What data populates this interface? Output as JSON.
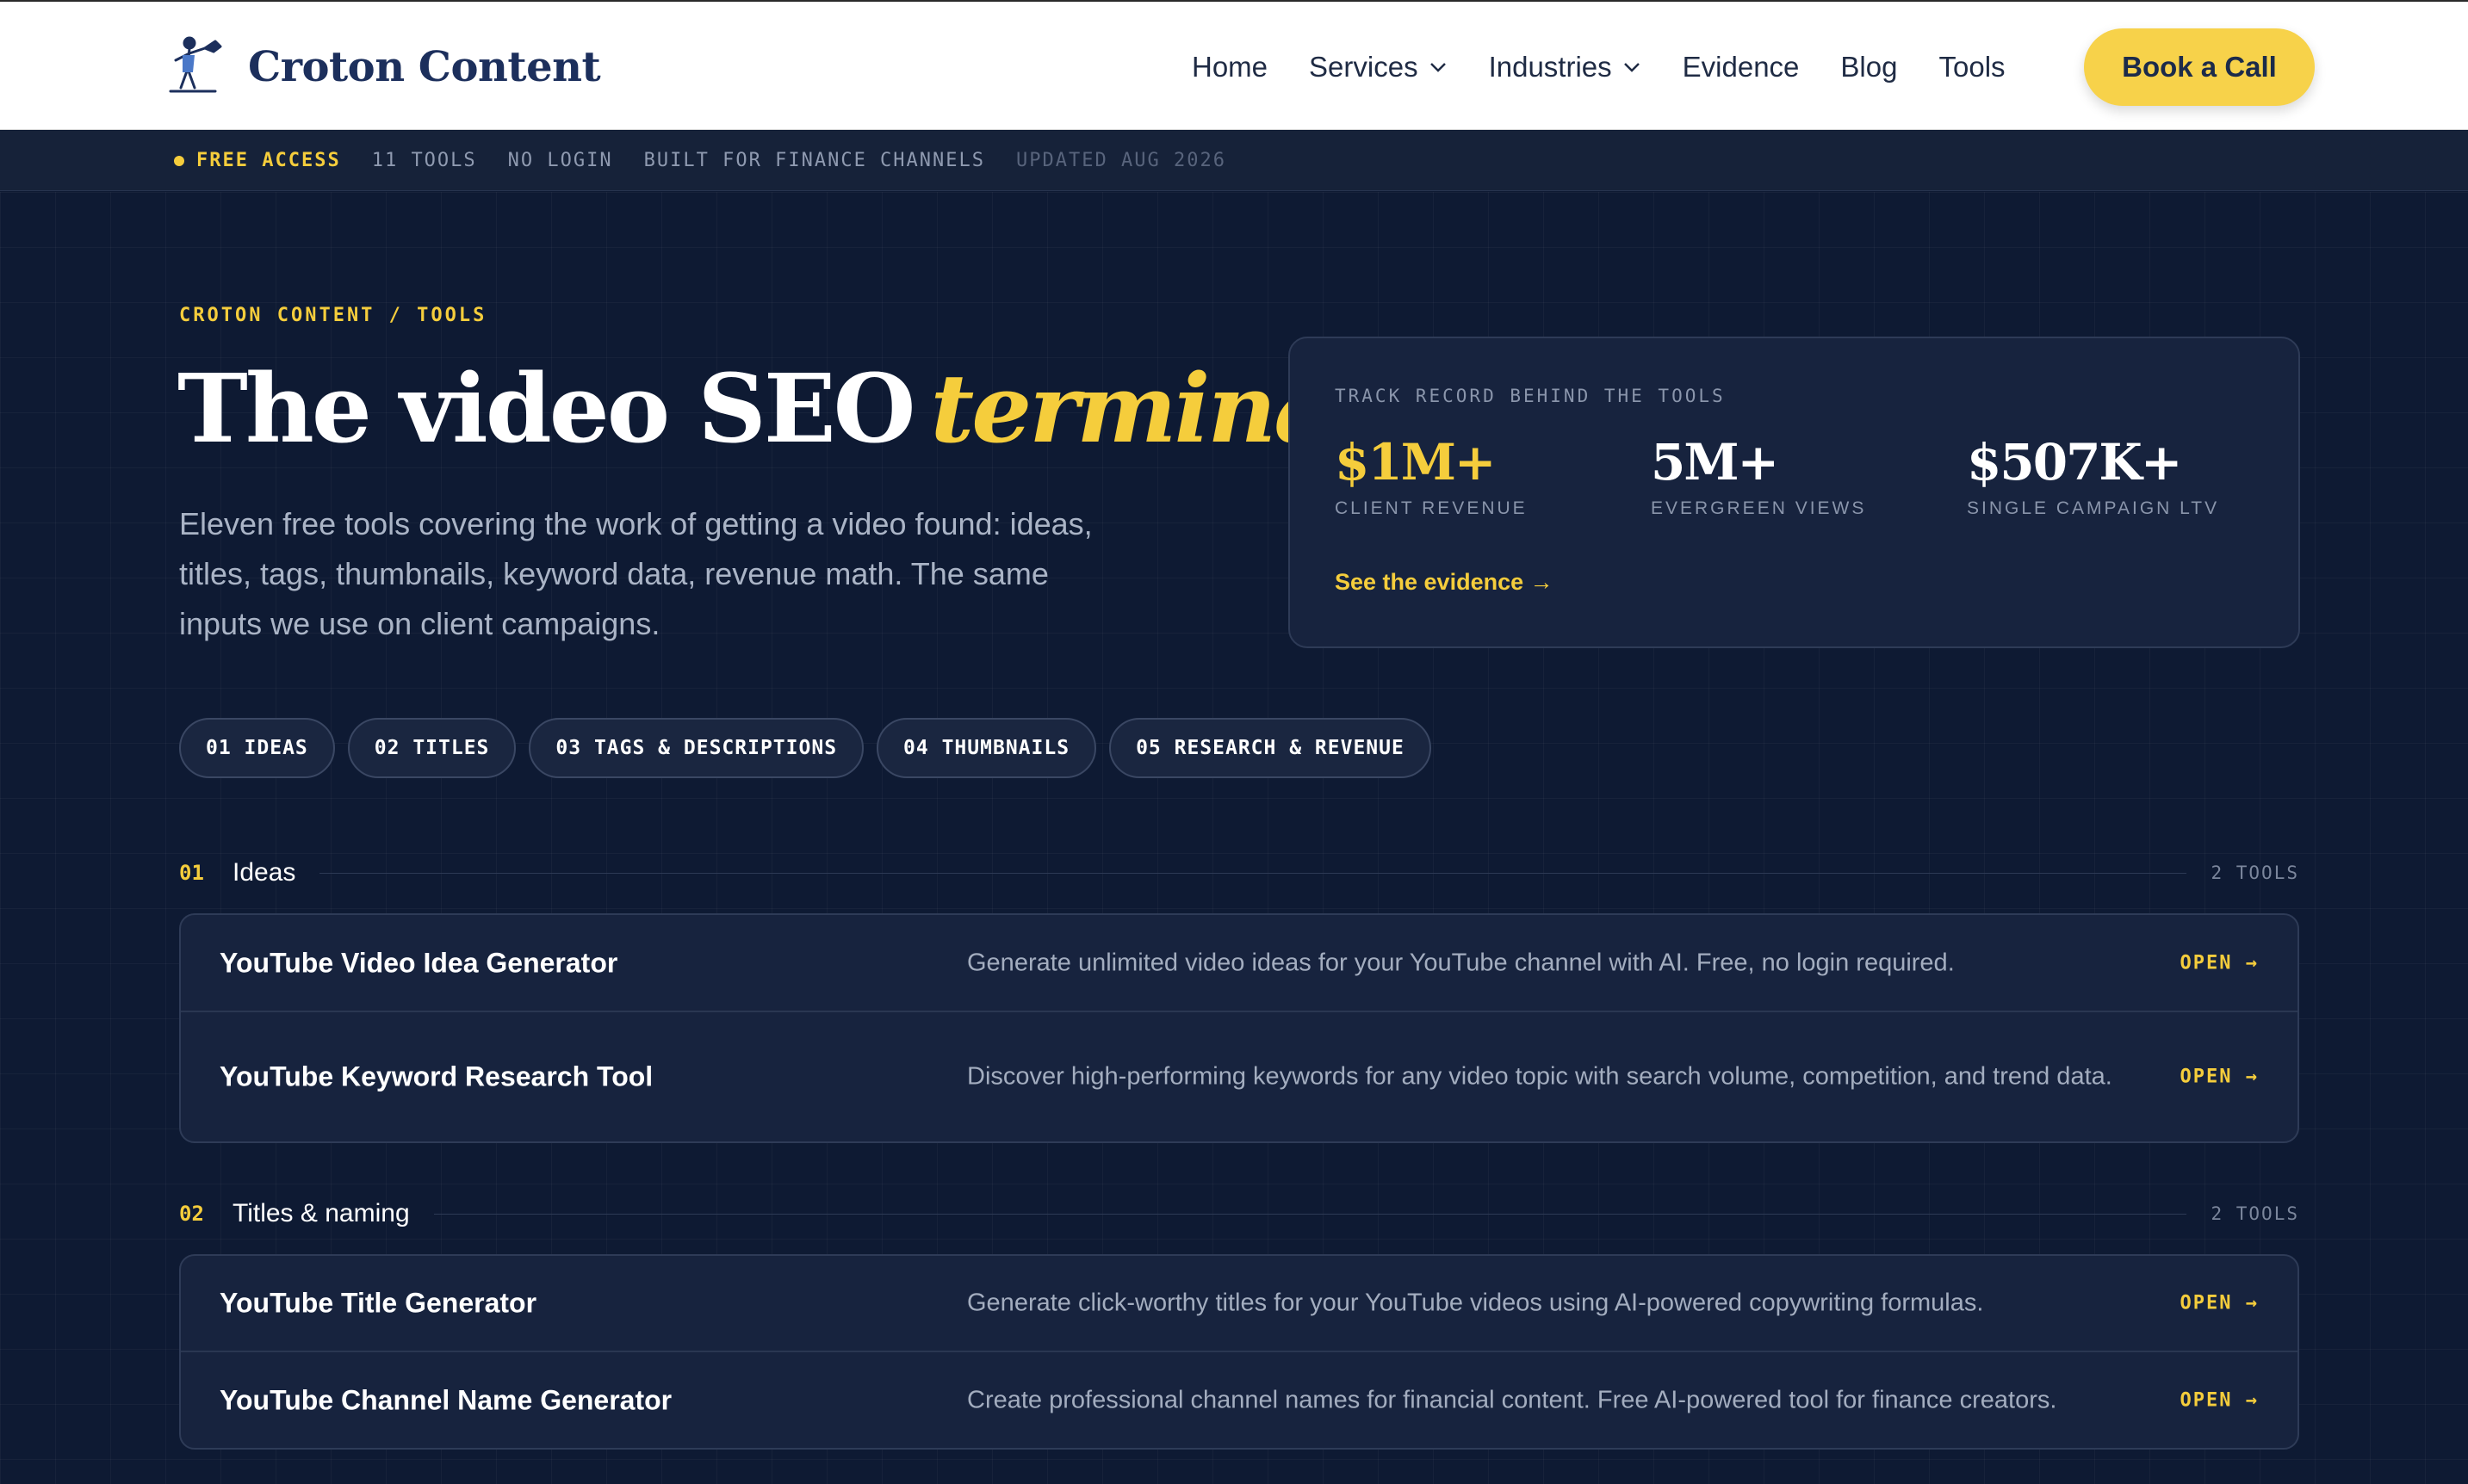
{
  "nav": {
    "brand": "Croton Content",
    "links": [
      {
        "label": "Home"
      },
      {
        "label": "Services"
      },
      {
        "label": "Industries"
      },
      {
        "label": "Evidence"
      },
      {
        "label": "Blog"
      },
      {
        "label": "Tools"
      }
    ],
    "cta": "Book a Call"
  },
  "ticker": {
    "items": [
      "FREE ACCESS",
      "11 TOOLS",
      "NO LOGIN",
      "BUILT FOR FINANCE CHANNELS",
      "UPDATED AUG 2026"
    ]
  },
  "hero": {
    "breadcrumb": "CROTON CONTENT / TOOLS",
    "title": "The video SEO",
    "title_accent": "terminal",
    "subtitle": "Eleven free tools covering the work of getting a video found: ideas, titles, tags, thumbnails, keyword data, revenue math. The same inputs we use on client campaigns."
  },
  "record": {
    "label": "TRACK RECORD BEHIND THE TOOLS",
    "stats": [
      {
        "value": "$1M+",
        "label": "CLIENT REVENUE"
      },
      {
        "value": "5M+",
        "label": "EVERGREEN VIEWS"
      },
      {
        "value": "$507K+",
        "label": "SINGLE CAMPAIGN LTV"
      }
    ],
    "link": "See the evidence →"
  },
  "pills": [
    "01 IDEAS",
    "02 TITLES",
    "03 TAGS & DESCRIPTIONS",
    "04 THUMBNAILS",
    "05 RESEARCH & REVENUE"
  ],
  "sections": [
    {
      "num": "01",
      "title": "Ideas",
      "count": "2 TOOLS",
      "tools": [
        {
          "name": "YouTube Video Idea Generator",
          "desc": "Generate unlimited video ideas for your YouTube channel with AI. Free, no login required.",
          "open": "OPEN →"
        },
        {
          "name": "YouTube Keyword Research Tool",
          "desc": "Discover high-performing keywords for any video topic with search volume, competition, and trend data.",
          "open": "OPEN →"
        }
      ]
    },
    {
      "num": "02",
      "title": "Titles & naming",
      "count": "2 TOOLS",
      "tools": [
        {
          "name": "YouTube Title Generator",
          "desc": "Generate click-worthy titles for your YouTube videos using AI-powered copywriting formulas.",
          "open": "OPEN →"
        },
        {
          "name": "YouTube Channel Name Generator",
          "desc": "Create professional channel names for financial content. Free AI-powered tool for finance creators.",
          "open": "OPEN →"
        }
      ]
    }
  ],
  "colors": {
    "accent": "#f5cd3c",
    "background": "#0e1a33",
    "card": "#17233e"
  },
  "icons": {
    "logo": "bull-rider-logo-icon",
    "dropdown": "chevron-down-icon"
  }
}
